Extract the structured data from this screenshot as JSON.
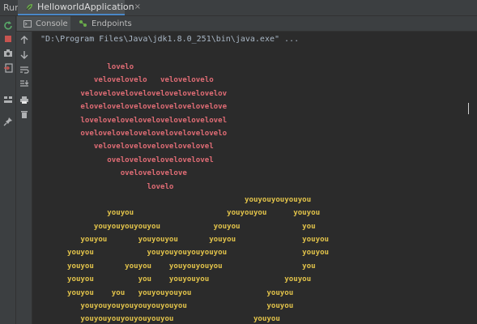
{
  "window": {
    "run_label": "Run:",
    "tab_title": "HelloworldApplication",
    "tab_close": "×"
  },
  "subtabs": {
    "console": "Console",
    "endpoints": "Endpoints"
  },
  "console": {
    "command": "\"D:\\Program Files\\Java\\jdk1.8.0_251\\bin\\java.exe\" ...",
    "love_lines": [
      "         lovelo",
      "      velovelovelo   velovelovelo",
      "   velovelovelovelovelovelovelovelov",
      "   elovelovelovelovelovelovelovelove",
      "   lovelovelovelovelovelovelovelovel",
      "   ovelovelovelovelovelovelovelovelo",
      "      velovelovelovelovelovelovel",
      "         ovelovelovelovelovelovel",
      "            ovelovelovelove",
      "                  lovelo"
    ],
    "you_lines": [
      "                                        youyouyouyouyou",
      "         youyou                     youyouyou      youyou",
      "      youyouyouyouyou            youyou              you",
      "   youyou       youyouyou       youyou               youyou",
      "youyou            youyouyouyouyouyou                 youyou",
      "youyou       youyou    youyouyouyou                  you",
      "youyou          you    youyouyou                 youyou",
      "youyou    you   youyouyouyou                 youyou",
      "   youyouyouyouyouyouyouyou                  youyou",
      "   youyouyouyouyouyouyou                  youyou"
    ]
  },
  "colors": {
    "love": "#e06c75",
    "you": "#e2c34a",
    "accent": "#4a88c7"
  },
  "icons": {
    "leftbar": [
      "rerun-icon",
      "stop-icon",
      "camera-icon",
      "exit-icon",
      "layout-icon",
      "pin-icon"
    ],
    "toolbar": [
      "arrow-up-icon",
      "arrow-down-icon",
      "soft-wrap-icon",
      "scroll-to-end-icon",
      "print-icon",
      "trash-icon"
    ]
  }
}
